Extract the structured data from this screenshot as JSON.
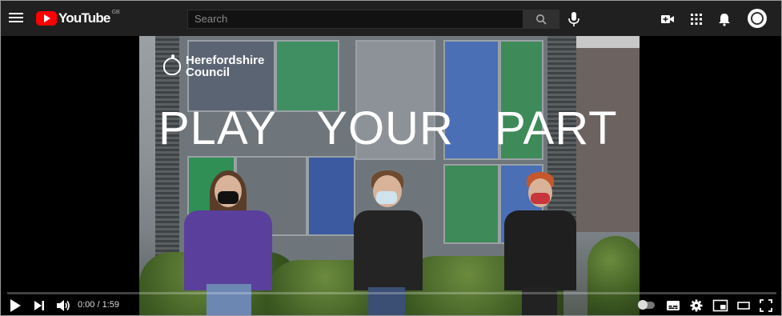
{
  "header": {
    "logo_text": "YouTube",
    "region": "GB",
    "search_placeholder": "Search"
  },
  "video": {
    "council_name_line1": "Herefordshire",
    "council_name_line2": "Council",
    "headline": "PLAY   YOUR   PART"
  },
  "player": {
    "time_display": "0:00 / 1:59",
    "progress_fraction": 0,
    "progress_color": "#ff0000"
  },
  "icons": {
    "menu": "hamburger-menu-icon",
    "search": "search-icon",
    "mic": "microphone-icon",
    "create": "create-video-icon",
    "apps": "apps-grid-icon",
    "notifications": "bell-icon",
    "account": "avatar-icon",
    "play": "play-icon",
    "next": "next-icon",
    "volume": "volume-icon",
    "autoplay": "autoplay-toggle-icon",
    "subtitles": "subtitles-icon",
    "settings": "gear-icon",
    "miniplayer": "miniplayer-icon",
    "theater": "theater-mode-icon",
    "fullscreen": "fullscreen-icon"
  },
  "colors": {
    "topbar": "#202020",
    "brand_red": "#ff0000",
    "player_bg": "#000000"
  }
}
